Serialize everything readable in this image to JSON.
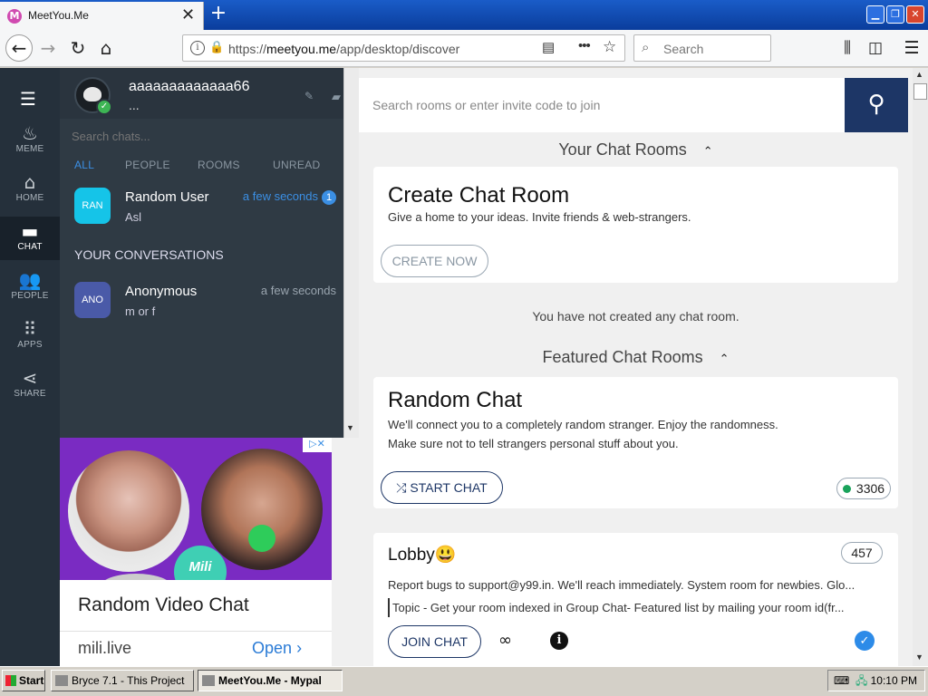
{
  "browser": {
    "tab_title": "MeetYou.Me",
    "tab_favicon": "M",
    "url_prefix": "https://",
    "url_host": "meetyou.me",
    "url_path": "/app/desktop/discover",
    "search_placeholder": "Search"
  },
  "leftnav": {
    "items": [
      {
        "label": "MEME",
        "icon": "flame-icon"
      },
      {
        "label": "HOME",
        "icon": "home-icon"
      },
      {
        "label": "CHAT",
        "icon": "chat-icon"
      },
      {
        "label": "PEOPLE",
        "icon": "people-icon"
      },
      {
        "label": "APPS",
        "icon": "apps-grid-icon"
      },
      {
        "label": "SHARE",
        "icon": "share-icon"
      }
    ],
    "active": "CHAT"
  },
  "user": {
    "name": "aaaaaaaaaaaaa66",
    "status": "..."
  },
  "chats": {
    "search_placeholder": "Search chats...",
    "filters": [
      "ALL",
      "PEOPLE",
      "ROOMS",
      "UNREAD"
    ],
    "active_filter": "ALL",
    "conversations_heading": "YOUR CONVERSATIONS",
    "pinned": {
      "avatar": "RAN",
      "name": "Random User",
      "message": "Asl",
      "time": "a few seconds",
      "unread": "1",
      "avatar_color": "#15c4e8",
      "time_color": "#3b8fe4"
    },
    "conversations": [
      {
        "avatar": "ANO",
        "name": "Anonymous",
        "message": "m or f",
        "time": "a few seconds",
        "avatar_color": "#4a5aa8",
        "time_color": "#9aa5af"
      }
    ]
  },
  "ad": {
    "title": "Random Video Chat",
    "domain": "mili.live",
    "cta": "Open",
    "logo_text": "Mili",
    "close_label": "▷✕"
  },
  "main": {
    "room_search_placeholder": "Search rooms or enter invite code to join",
    "your_rooms_title": "Your Chat Rooms",
    "create_card": {
      "title": "Create Chat Room",
      "desc": "Give a home to your ideas. Invite friends & web-strangers.",
      "button": "CREATE NOW"
    },
    "no_rooms_text": "You have not created any chat room.",
    "featured_title": "Featured Chat Rooms",
    "random_card": {
      "title": "Random Chat",
      "desc_line1": "We'll connect you to a completely random stranger. Enjoy the randomness.",
      "desc_line2": "Make sure not to tell strangers personal stuff about you.",
      "button": "START CHAT",
      "online_count": "3306"
    },
    "lobby_card": {
      "title": "Lobby😃",
      "member_count": "457",
      "desc": "Report bugs to support@y99.in. We'll reach immediately. System room for newbies. Glo...",
      "topic": "Topic - Get your room indexed in Group Chat- Featured list by mailing your room id(fr...",
      "button": "JOIN CHAT"
    }
  },
  "taskbar": {
    "start": "Start",
    "tasks": [
      "Bryce 7.1 - This Project",
      "MeetYou.Me - Mypal"
    ],
    "clock": "10:10 PM"
  },
  "colors": {
    "accent_dark": "#1d3666",
    "sidebar_bg": "#25303b",
    "chatpane_bg": "#2f3a44",
    "link_blue": "#3b8fe4",
    "online_green": "#1aa35b"
  }
}
